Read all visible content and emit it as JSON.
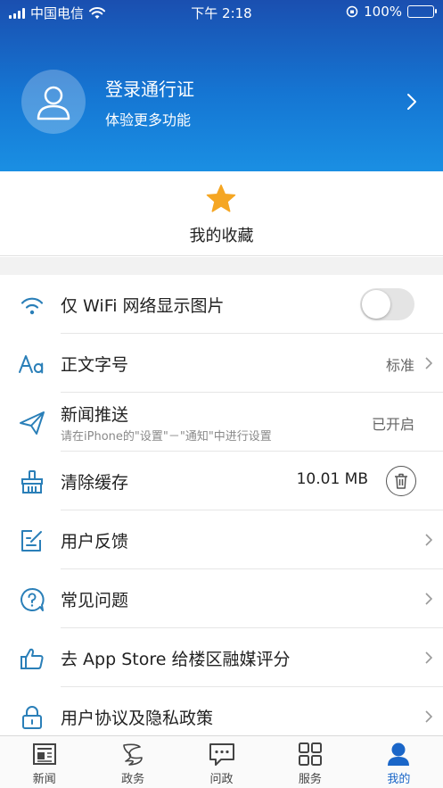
{
  "status_bar": {
    "carrier": "中国电信",
    "time": "下午 2:18",
    "battery": "100%",
    "battery_level": 1.0
  },
  "header": {
    "title": "登录通行证",
    "subtitle": "体验更多功能"
  },
  "favorites": {
    "label": "我的收藏"
  },
  "settings": {
    "wifi_images": {
      "label": "仅 WiFi 网络显示图片",
      "enabled": false
    },
    "font_size": {
      "label": "正文字号",
      "value": "标准"
    },
    "push": {
      "label": "新闻推送",
      "sub": "请在iPhone的\"设置\"－\"通知\"中进行设置",
      "value": "已开启"
    },
    "cache": {
      "label": "清除缓存",
      "value": "10.01 MB"
    },
    "feedback": {
      "label": "用户反馈"
    },
    "faq": {
      "label": "常见问题"
    },
    "rate": {
      "label": "去 App Store 给楼区融媒评分"
    },
    "privacy": {
      "label": "用户协议及隐私政策"
    }
  },
  "tabs": [
    {
      "label": "新闻",
      "icon": "news-icon"
    },
    {
      "label": "政务",
      "icon": "gov-icon"
    },
    {
      "label": "问政",
      "icon": "chat-icon"
    },
    {
      "label": "服务",
      "icon": "grid-icon"
    },
    {
      "label": "我的",
      "icon": "user-icon",
      "active": true
    }
  ],
  "colors": {
    "header_top": "#1a4fb0",
    "header_bottom": "#1a8fe3",
    "icon_blue": "#2a7fb8",
    "star": "#f5a623",
    "active_tab": "#1a66c8"
  }
}
